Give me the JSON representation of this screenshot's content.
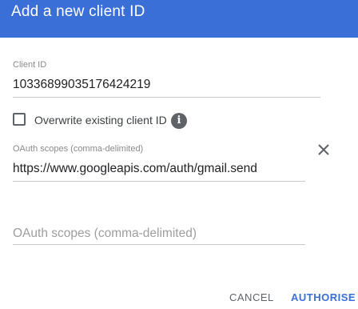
{
  "dialog": {
    "title": "Add a new client ID"
  },
  "client_id": {
    "label": "Client ID",
    "value": "10336899035176424219"
  },
  "overwrite": {
    "label": "Overwrite existing client ID",
    "checked": false,
    "info_icon": "info-icon"
  },
  "scopes": {
    "label": "OAuth scopes (comma-delimited)",
    "value": "https://www.googleapis.com/auth/gmail.send",
    "remove_icon": "close-icon",
    "empty_placeholder": "OAuth scopes (comma-delimited)"
  },
  "actions": {
    "cancel_label": "CANCEL",
    "authorise_label": "AUTHORISE"
  },
  "colors": {
    "header": "#3a6fd8",
    "primary_button": "#3a6fd8"
  }
}
